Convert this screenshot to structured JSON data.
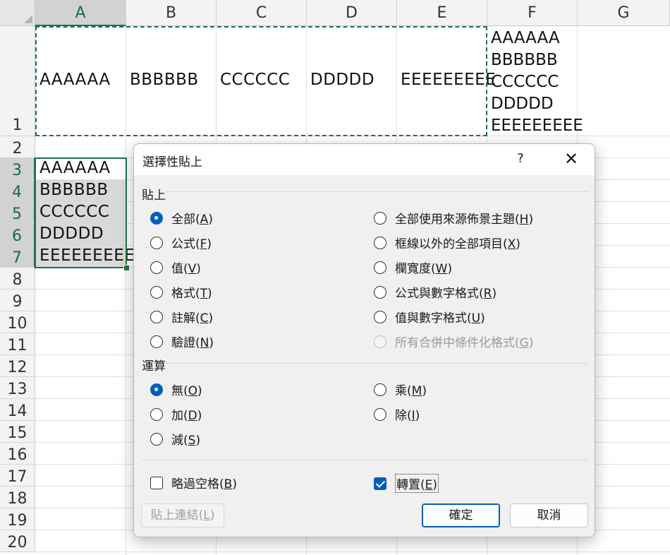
{
  "columns": [
    "A",
    "B",
    "C",
    "D",
    "E",
    "F",
    "G"
  ],
  "rows": [
    "1",
    "2",
    "3",
    "4",
    "5",
    "6",
    "7",
    "8",
    "9",
    "10",
    "11",
    "12",
    "13",
    "14",
    "15",
    "16",
    "17",
    "18",
    "19",
    "20"
  ],
  "row1_cells": [
    "AAAAAA",
    "BBBBBB",
    "CCCCCC",
    "DDDDD",
    "EEEEEEEEE"
  ],
  "f1_lines": "AAAAAA\nBBBBBB\nCCCCCC\nDDDDD\nEEEEEEEEE",
  "col_a_cells": [
    "AAAAAA",
    "BBBBBB",
    "CCCCCC",
    "DDDDD",
    "EEEEEEEEE"
  ],
  "dialog": {
    "title": "選擇性貼上",
    "help": "?",
    "close": "✕",
    "paste_group": "貼上",
    "paste_options": [
      {
        "label": "全部(",
        "key": "A",
        "end": ")"
      },
      {
        "label": "公式(",
        "key": "F",
        "end": ")"
      },
      {
        "label": "值(",
        "key": "V",
        "end": ")"
      },
      {
        "label": "格式(",
        "key": "T",
        "end": ")"
      },
      {
        "label": "註解(",
        "key": "C",
        "end": ")"
      },
      {
        "label": "驗證(",
        "key": "N",
        "end": ")"
      },
      {
        "label": "全部使用來源佈景主題(",
        "key": "H",
        "end": ")"
      },
      {
        "label": "框線以外的全部項目(",
        "key": "X",
        "end": ")"
      },
      {
        "label": "欄寬度(",
        "key": "W",
        "end": ")"
      },
      {
        "label": "公式與數字格式(",
        "key": "R",
        "end": ")"
      },
      {
        "label": "值與數字格式(",
        "key": "U",
        "end": ")"
      },
      {
        "label": "所有合併中條件化格式(",
        "key": "G",
        "end": ")"
      }
    ],
    "operation_group": "運算",
    "operation_options": [
      {
        "label": "無(",
        "key": "O",
        "end": ")"
      },
      {
        "label": "加(",
        "key": "D",
        "end": ")"
      },
      {
        "label": "減(",
        "key": "S",
        "end": ")"
      },
      {
        "label": "乘(",
        "key": "M",
        "end": ")"
      },
      {
        "label": "除(",
        "key": "I",
        "end": ")"
      }
    ],
    "skip_blanks": {
      "label": "略過空格(",
      "key": "B",
      "end": ")",
      "checked": false
    },
    "transpose": {
      "label": "轉置(",
      "key": "E",
      "end": ")",
      "checked": true
    },
    "paste_link": "貼上連結(",
    "paste_link_key": "L",
    "paste_link_end": ")",
    "ok": "確定",
    "cancel": "取消",
    "selected_paste": "全部",
    "selected_operation": "無",
    "accent": "#005fb8"
  },
  "colors": {
    "sheet_accent": "#217346"
  }
}
